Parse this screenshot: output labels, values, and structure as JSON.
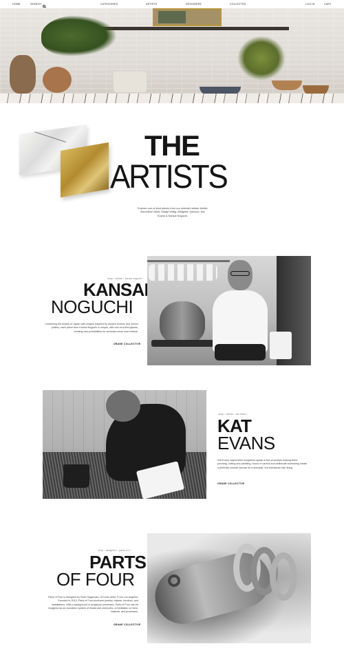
{
  "nav": {
    "home": "HOME",
    "search": "SEARCH",
    "categories": "CATEGORIES",
    "artists": "ARTISTS",
    "designers": "DESIGNERS",
    "collected": "COLLECTED",
    "login": "LOG IN",
    "cart": "CART"
  },
  "artists_heading": {
    "line1": "THE",
    "line2": "ARTISTS",
    "intro": "Explore one-of-kind pieces from our selected artists: Atelier Benedicte Vallet, Margit Wittig, Bridgette Johnson, Kat Evans & Kansai Noguchi."
  },
  "artists": [
    {
      "breadcrumb": [
        "shop",
        "artists",
        "kansai noguchi"
      ],
      "first": "KANSAI",
      "last": "NOGUCHI",
      "description": "Combining the beauty of Japan with shapes inspired by ancient Greece and Jomon pottery, each piece from Kansai Noguchi is unique, with one-of-a-kind glazes, creating new possibilities for ceramics never seen before.",
      "tag": "ORANE COLLECTIVE"
    },
    {
      "breadcrumb": [
        "shop",
        "artists",
        "kat evans"
      ],
      "first": "KAT",
      "last": "EVANS",
      "description": "Kat Evans' asymmetric sculptures speak of the processes making them: pinching, coiling and paddling. Hours of careful and deliberate burnishing create a perfectly smooth canvas for a dramatic, but intentional raku firing.",
      "tag": "ORANE COLLECTIVE"
    },
    {
      "breadcrumb": [
        "shop",
        "designers",
        "parts of 4"
      ],
      "first": "PARTS",
      "last": "OF FOUR",
      "description": "Parts of Four is designed by Evan Hagerman, US born artist. From Los Angeles. Founded in 2013, Parts of Four produces jewelry, objects, furniture, and installations. With a background in sculptural processes, Parts of Four can be imagined as an evocation system of rituals and memories, a meditation on form, material, and processes.",
      "tag": "ORANE COLLECTIVE"
    }
  ]
}
